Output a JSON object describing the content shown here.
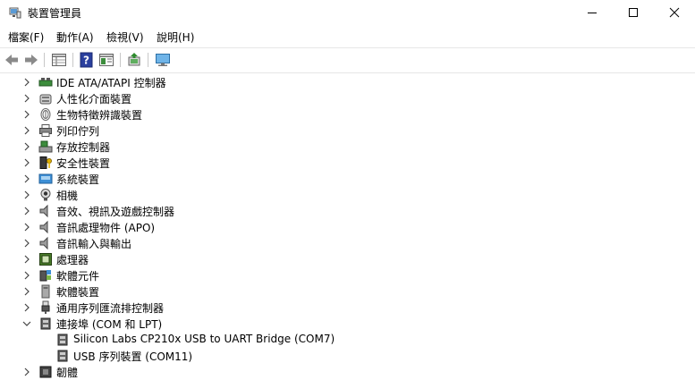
{
  "window": {
    "title": "裝置管理員"
  },
  "menu": [
    {
      "label": "檔案(F)"
    },
    {
      "label": "動作(A)"
    },
    {
      "label": "檢視(V)"
    },
    {
      "label": "說明(H)"
    }
  ],
  "toolbar": {
    "icons": [
      "back-arrow-icon",
      "forward-arrow-icon",
      "properties-grid-icon",
      "help-icon",
      "details-pane-icon",
      "update-driver-icon",
      "computer-monitor-icon"
    ]
  },
  "devices": {
    "ide": "IDE ATA/ATAPI 控制器",
    "hid": "人性化介面裝置",
    "biometric": "生物特徵辨識裝置",
    "print_queues": "列印佇列",
    "storage": "存放控制器",
    "security": "安全性裝置",
    "system": "系統裝置",
    "camera": "相機",
    "sound": "音效、視訊及遊戲控制器",
    "audio_processing": "音訊處理物件 (APO)",
    "audio_io": "音訊輸入與輸出",
    "processors": "處理器",
    "software_components": "軟體元件",
    "software_devices": "軟體裝置",
    "usb_controllers": "通用序列匯流排控制器",
    "ports": "連接埠 (COM 和 LPT)",
    "ports_children": [
      "Silicon Labs CP210x USB to UART Bridge (COM7)",
      "USB 序列裝置 (COM11)"
    ],
    "firmware": "韌體"
  },
  "colors": {
    "accent": "#1e73be",
    "chevron": "#444444"
  }
}
